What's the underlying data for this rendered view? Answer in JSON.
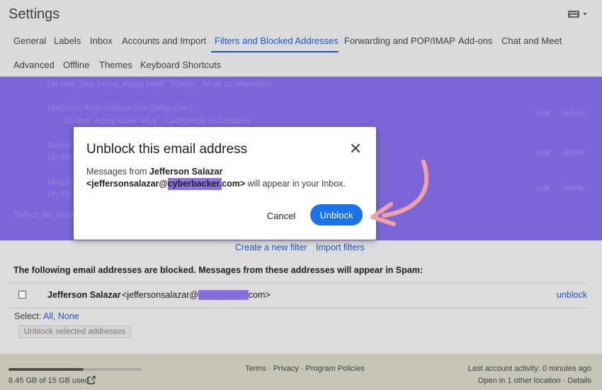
{
  "header": {
    "title": "Settings",
    "keyboard_icon": "keyboard-icon"
  },
  "tabs_row1": [
    "General",
    "Labels",
    "Inbox",
    "Accounts and Import",
    "Filters and Blocked Addresses",
    "Forwarding and POP/IMAP",
    "Add-ons",
    "Chat and Meet"
  ],
  "tabs_row2": [
    "Advanced",
    "Offline",
    "Themes",
    "Keyboard Shortcuts"
  ],
  "active_tab": "Filters and Blocked Addresses",
  "background_filters": {
    "line1": "Do this: Skip Inbox, Apply label \"Vibesh\", Mark as important",
    "line2": "Matches: from:(transaction@etsy.com)",
    "line3": "Do this: Apply label \"etsy\", Categorize as Updates",
    "line4": "Match",
    "line5": "Do thi",
    "line6": "Match",
    "line7": "Do thi",
    "line8": "Select: All, None",
    "edit_label": "edit",
    "delete_label": "delete"
  },
  "dialog": {
    "title": "Unblock this email address",
    "body_prefix": "Messages from ",
    "sender_name": "Jefferson Salazar",
    "sender_email_start": "<jeffersonsalazar@",
    "sender_email_redacted": "cyberbacker.",
    "sender_email_end": "com>",
    "body_suffix": " will appear in your Inbox.",
    "cancel_label": "Cancel",
    "unblock_label": "Unblock"
  },
  "filter_links": {
    "create": "Create a new filter",
    "import": "Import filters"
  },
  "blocked": {
    "message": "The following email addresses are blocked. Messages from these addresses will appear in Spam:",
    "rows": [
      {
        "name": "Jefferson Salazar",
        "email_start": "<jeffersonsalazar@",
        "email_redacted": "cyberbacker.",
        "email_end": "com>",
        "action": "unblock"
      }
    ],
    "select_label": "Select: ",
    "select_all": "All",
    "select_sep": ", ",
    "select_none": "None",
    "unblock_selected": "Unblock selected addresses"
  },
  "footer": {
    "storage": "8.45 GB of 15 GB used",
    "storage_fraction": 0.563,
    "policies": "Terms · Privacy · Program Policies",
    "activity": "Last account activity: 0 minutes ago",
    "location": "Open in 1 other location · Details"
  },
  "colors": {
    "overlay": "#7a66d8",
    "accent": "#1a73e8",
    "arrow": "#f4a0a0"
  }
}
